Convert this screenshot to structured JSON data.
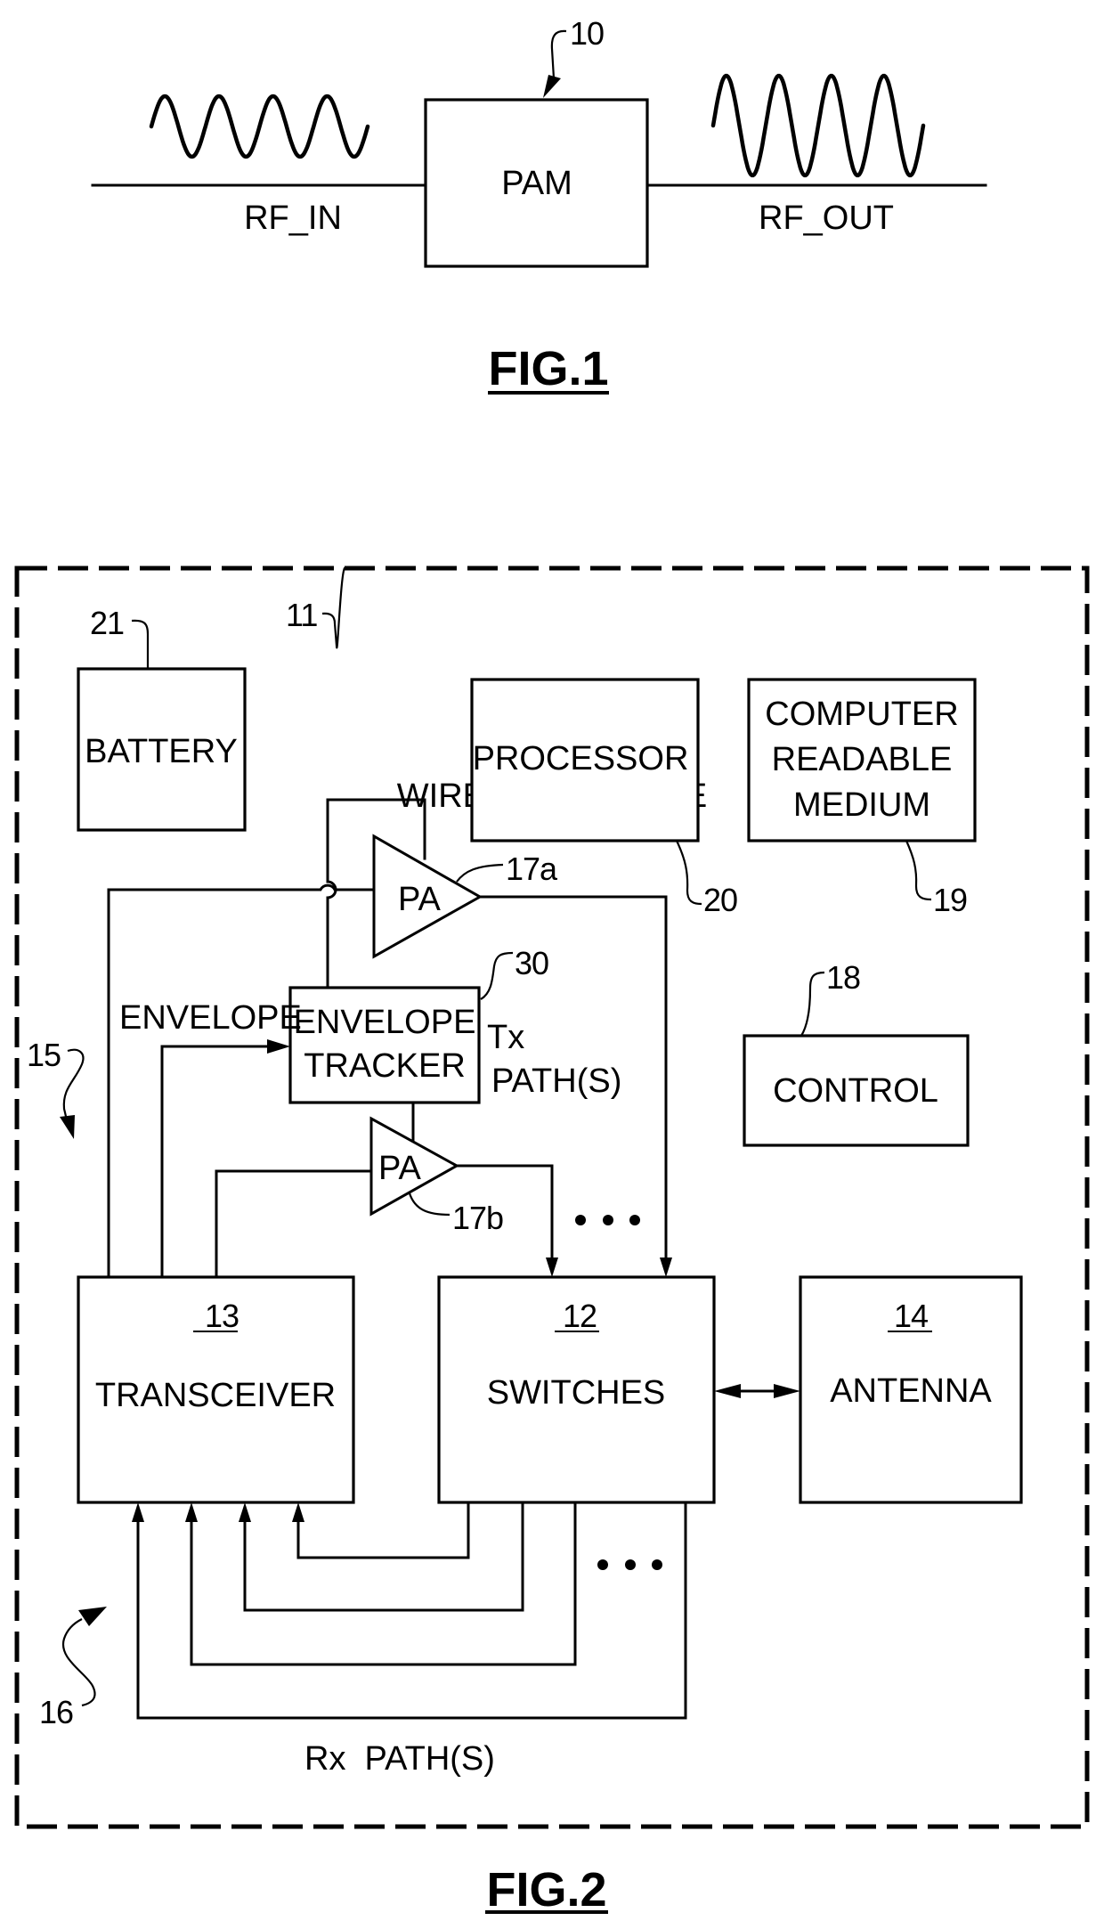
{
  "fig1": {
    "caption": "FIG.1",
    "ref_label": "10",
    "block_label": "PAM",
    "input_label": "RF_IN",
    "output_label": "RF_OUT",
    "input_signal": {
      "type": "sine",
      "cycles": 4,
      "amplitude": "small"
    },
    "output_signal": {
      "type": "sine",
      "cycles": 4,
      "amplitude": "large"
    }
  },
  "fig2": {
    "caption": "FIG.2",
    "device": {
      "ref": "11",
      "label": "WIRELESS DEVICE"
    },
    "blocks": {
      "battery": {
        "ref": "21",
        "label": "BATTERY"
      },
      "processor": {
        "ref": "20",
        "label": "PROCESSOR"
      },
      "crm": {
        "ref": "19",
        "lines": [
          "COMPUTER",
          "READABLE",
          "MEDIUM"
        ]
      },
      "control": {
        "ref": "18",
        "label": "CONTROL"
      },
      "envelope_tracker": {
        "ref": "30",
        "lines": [
          "ENVELOPE",
          "TRACKER"
        ]
      },
      "pa_a": {
        "ref": "17a",
        "label": "PA"
      },
      "pa_b": {
        "ref": "17b",
        "label": "PA"
      },
      "transceiver": {
        "ref": "13",
        "label": "TRANSCEIVER"
      },
      "switches": {
        "ref": "12",
        "label": "SWITCHES"
      },
      "antenna": {
        "ref": "14",
        "label": "ANTENNA"
      }
    },
    "signal_labels": {
      "envelope": "ENVELOPE",
      "tx_paths": [
        "Tx",
        "PATH(S)"
      ],
      "rx_paths": "Rx  PATH(S)"
    },
    "group_refs": {
      "tx_group": "15",
      "rx_group": "16"
    },
    "ellipsis": "• • •"
  }
}
